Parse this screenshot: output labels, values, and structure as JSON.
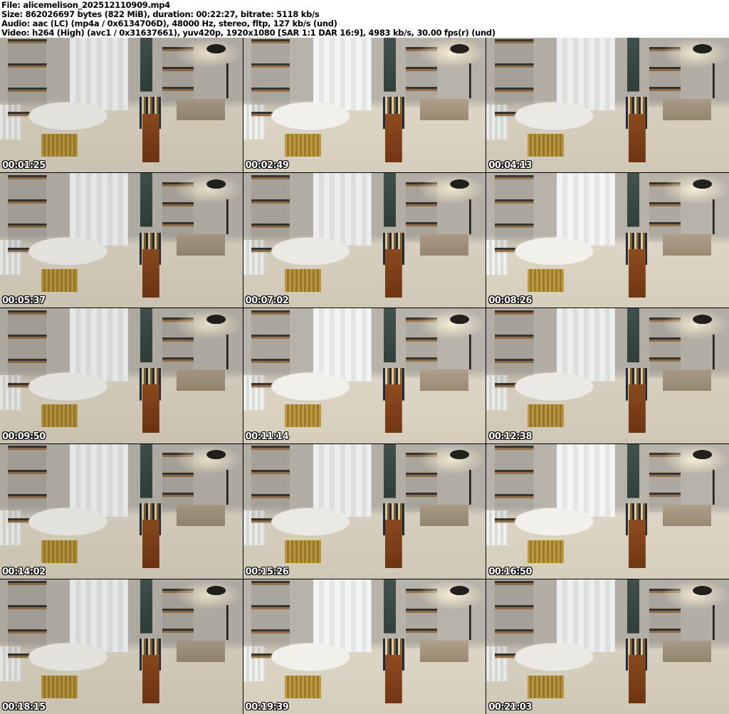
{
  "header": {
    "lines": [
      "File: alicemelison_202512110909.mp4",
      "Size: 862026697 bytes (822 MiB), duration: 00:22:27, bitrate: 5118 kb/s",
      "Audio: aac (LC) (mp4a / 0x6134706D), 48000 Hz, stereo, fltp, 127 kb/s (und)",
      "Video: h264 (High) (avc1 / 0x31637661), yuv420p, 1920x1080 [SAR 1:1 DAR 16:9], 4983 kb/s, 30.00 fps(r) (und)"
    ]
  },
  "grid": {
    "columns": 3,
    "rows": 5,
    "thumbnails": [
      {
        "timestamp": "00:01:25"
      },
      {
        "timestamp": "00:02:49"
      },
      {
        "timestamp": "00:04:13"
      },
      {
        "timestamp": "00:05:37"
      },
      {
        "timestamp": "00:07:02"
      },
      {
        "timestamp": "00:08:26"
      },
      {
        "timestamp": "00:09:50"
      },
      {
        "timestamp": "00:11:14"
      },
      {
        "timestamp": "00:12:38"
      },
      {
        "timestamp": "00:14:02"
      },
      {
        "timestamp": "00:15:26"
      },
      {
        "timestamp": "00:16:50"
      },
      {
        "timestamp": "00:18:15"
      },
      {
        "timestamp": "00:19:39"
      },
      {
        "timestamp": "00:21:03"
      }
    ]
  },
  "colors": {
    "header_background": "#ffffff",
    "header_text": "#000000",
    "grid_gap": "#000000",
    "timestamp_text": "#ffffff",
    "timestamp_outline": "#000000",
    "carpet": "#d0c8b6",
    "wall": "#b3aea5",
    "table_base": "#b8953e",
    "chair_wood": "#8a4a1f"
  }
}
